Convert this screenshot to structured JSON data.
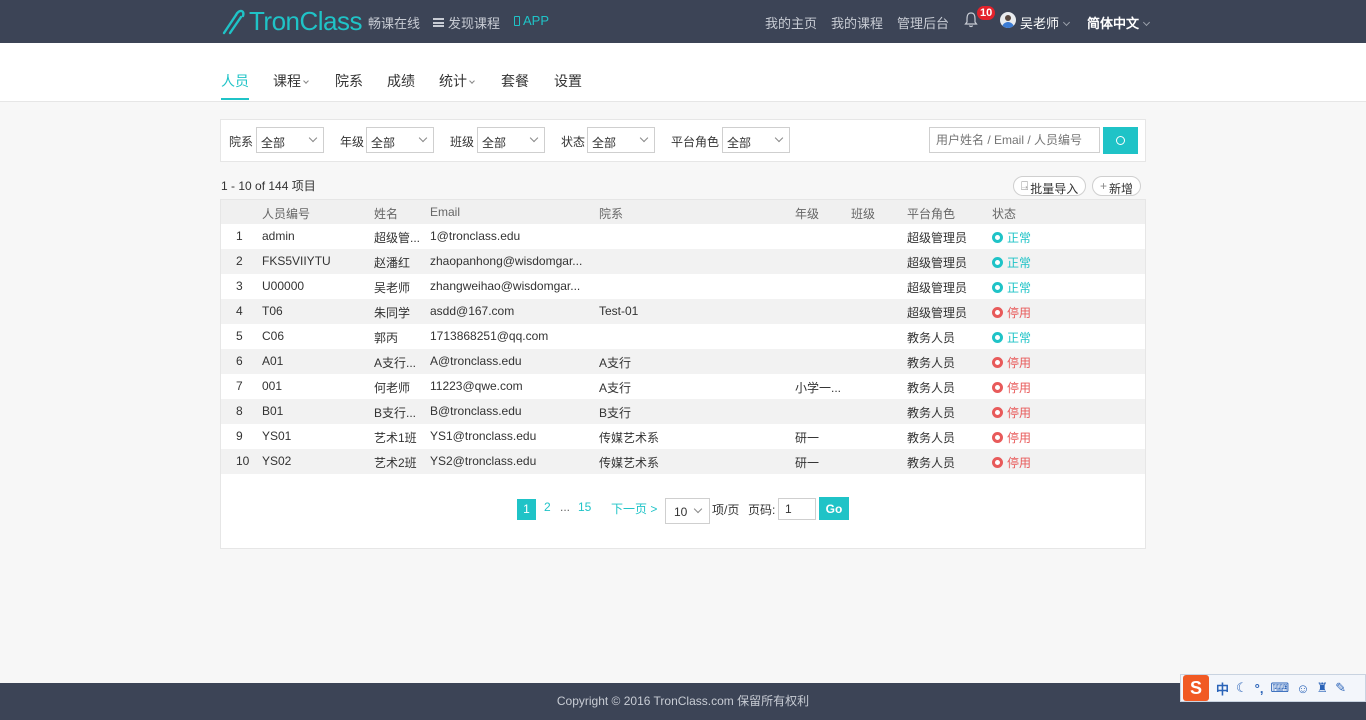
{
  "header": {
    "logo_text": "TronClass",
    "slogan": "畅课在线",
    "discover": "发现课程",
    "app": "APP",
    "my_home": "我的主页",
    "my_courses": "我的课程",
    "admin": "管理后台",
    "notification_count": "10",
    "user_name": "吴老师",
    "language": "简体中文"
  },
  "tabs": [
    {
      "label": "人员",
      "active": true
    },
    {
      "label": "课程",
      "dropdown": true
    },
    {
      "label": "院系"
    },
    {
      "label": "成绩"
    },
    {
      "label": "统计",
      "dropdown": true
    },
    {
      "label": "套餐"
    },
    {
      "label": "设置"
    }
  ],
  "filters": [
    {
      "label": "院系",
      "value": "全部"
    },
    {
      "label": "年级",
      "value": "全部"
    },
    {
      "label": "班级",
      "value": "全部"
    },
    {
      "label": "状态",
      "value": "全部"
    },
    {
      "label": "平台角色",
      "value": "全部"
    }
  ],
  "search": {
    "placeholder": "用户姓名 / Email / 人员编号"
  },
  "summary": "1 - 10 of 144 项目",
  "actions": {
    "import": "批量导入",
    "add": "新增"
  },
  "table": {
    "headers": [
      "人员编号",
      "姓名",
      "Email",
      "院系",
      "年级",
      "班级",
      "平台角色",
      "状态"
    ],
    "rows": [
      {
        "n": "1",
        "id": "admin",
        "name": "超级管...",
        "email": "1@tronclass.edu",
        "dept": "",
        "grade": "",
        "cls": "",
        "role": "超级管理员",
        "status": "正常",
        "ok": true
      },
      {
        "n": "2",
        "id": "FKS5VIIYTU",
        "name": "赵潘红",
        "email": "zhaopanhong@wisdomgar...",
        "dept": "",
        "grade": "",
        "cls": "",
        "role": "超级管理员",
        "status": "正常",
        "ok": true
      },
      {
        "n": "3",
        "id": "U00000",
        "name": "吴老师",
        "email": "zhangweihao@wisdomgar...",
        "dept": "",
        "grade": "",
        "cls": "",
        "role": "超级管理员",
        "status": "正常",
        "ok": true
      },
      {
        "n": "4",
        "id": "T06",
        "name": "朱同学",
        "email": "asdd@167.com",
        "dept": "Test-01",
        "grade": "",
        "cls": "",
        "role": "超级管理员",
        "status": "停用",
        "ok": false
      },
      {
        "n": "5",
        "id": "C06",
        "name": "郭丙",
        "email": "1713868251@qq.com",
        "dept": "",
        "grade": "",
        "cls": "",
        "role": "教务人员",
        "status": "正常",
        "ok": true
      },
      {
        "n": "6",
        "id": "A01",
        "name": "A支行...",
        "email": "A@tronclass.edu",
        "dept": "A支行",
        "grade": "",
        "cls": "",
        "role": "教务人员",
        "status": "停用",
        "ok": false
      },
      {
        "n": "7",
        "id": "001",
        "name": "何老师",
        "email": "11223@qwe.com",
        "dept": "A支行",
        "grade": "小学一...",
        "cls": "",
        "role": "教务人员",
        "status": "停用",
        "ok": false
      },
      {
        "n": "8",
        "id": "B01",
        "name": "B支行...",
        "email": "B@tronclass.edu",
        "dept": "B支行",
        "grade": "",
        "cls": "",
        "role": "教务人员",
        "status": "停用",
        "ok": false
      },
      {
        "n": "9",
        "id": "YS01",
        "name": "艺术1班",
        "email": "YS1@tronclass.edu",
        "dept": "传媒艺术系",
        "grade": "研一",
        "cls": "",
        "role": "教务人员",
        "status": "停用",
        "ok": false
      },
      {
        "n": "10",
        "id": "YS02",
        "name": "艺术2班",
        "email": "YS2@tronclass.edu",
        "dept": "传媒艺术系",
        "grade": "研一",
        "cls": "",
        "role": "教务人员",
        "status": "停用",
        "ok": false
      }
    ]
  },
  "pagination": {
    "current": "1",
    "page2": "2",
    "ellipsis": "...",
    "last": "15",
    "next": "下一页 >",
    "page_size": "10",
    "per_page_label": "项/页",
    "page_label": "页码:",
    "page_input": "1",
    "go": "Go"
  },
  "footer": "Copyright © 2016 TronClass.com 保留所有权利",
  "ime": {
    "logo": "S",
    "mode": "中"
  },
  "colors": {
    "accent": "#1fc3c7",
    "nav_bg": "#3c4456",
    "danger": "#e85a5a"
  }
}
